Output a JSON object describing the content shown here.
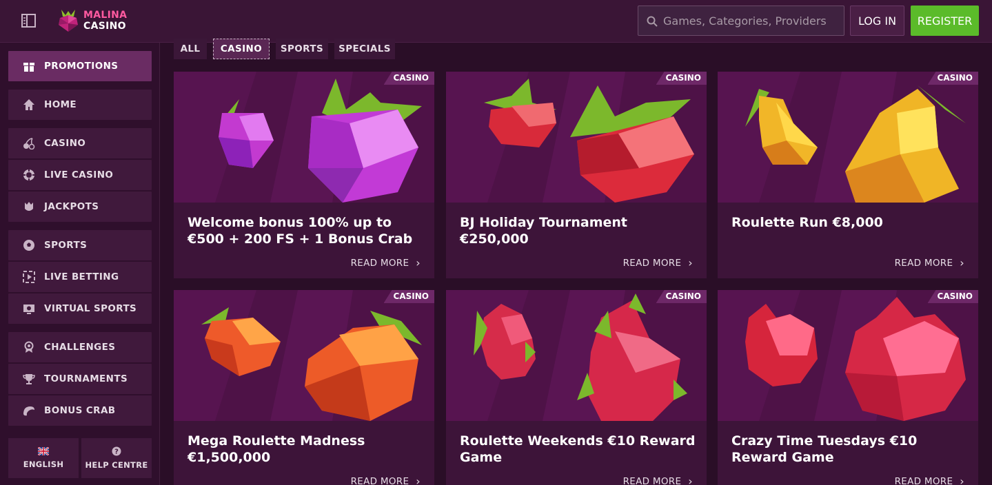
{
  "header": {
    "logo_line1": "MALINA",
    "logo_line2": "CASINO",
    "search_placeholder": "Games, Categories, Providers",
    "login_label": "LOG IN",
    "register_label": "REGISTER"
  },
  "sidebar": {
    "items": [
      {
        "label": "PROMOTIONS",
        "icon": "gift-icon"
      },
      {
        "label": "HOME",
        "icon": "home-icon"
      },
      {
        "label": "CASINO",
        "icon": "cherries-icon"
      },
      {
        "label": "LIVE CASINO",
        "icon": "chip-icon"
      },
      {
        "label": "JACKPOTS",
        "icon": "jackpot-icon"
      },
      {
        "label": "SPORTS",
        "icon": "soccer-ball-icon"
      },
      {
        "label": "LIVE BETTING",
        "icon": "live-screen-icon"
      },
      {
        "label": "VIRTUAL SPORTS",
        "icon": "virtual-sports-icon"
      },
      {
        "label": "CHALLENGES",
        "icon": "medal-icon"
      },
      {
        "label": "TOURNAMENTS",
        "icon": "trophy-icon"
      },
      {
        "label": "BONUS CRAB",
        "icon": "crab-icon"
      }
    ],
    "footer": {
      "language_label": "ENGLISH",
      "help_label": "HELP CENTRE"
    }
  },
  "tabs": {
    "all": "ALL",
    "casino": "CASINO",
    "sports": "SPORTS",
    "specials": "SPECIALS"
  },
  "cards": [
    {
      "badge": "CASINO",
      "title": "Welcome bonus 100% up to €500 + 200 FS + 1 Bonus Crab",
      "more": "READ MORE"
    },
    {
      "badge": "CASINO",
      "title": "BJ Holiday Tournament €250,000",
      "more": "READ MORE"
    },
    {
      "badge": "CASINO",
      "title": "Roulette Run €8,000",
      "more": "READ MORE"
    },
    {
      "badge": "CASINO",
      "title": "Mega Roulette Madness €1,500,000",
      "more": "READ MORE"
    },
    {
      "badge": "CASINO",
      "title": "Roulette Weekends €10 Reward Game",
      "more": "READ MORE"
    },
    {
      "badge": "CASINO",
      "title": "Crazy Time Tuesdays €10 Reward Game",
      "more": "READ MORE"
    }
  ],
  "colors": {
    "accent_register": "#5bbb2a",
    "brand_pink": "#ff5aa0",
    "background": "#2a0e27"
  }
}
